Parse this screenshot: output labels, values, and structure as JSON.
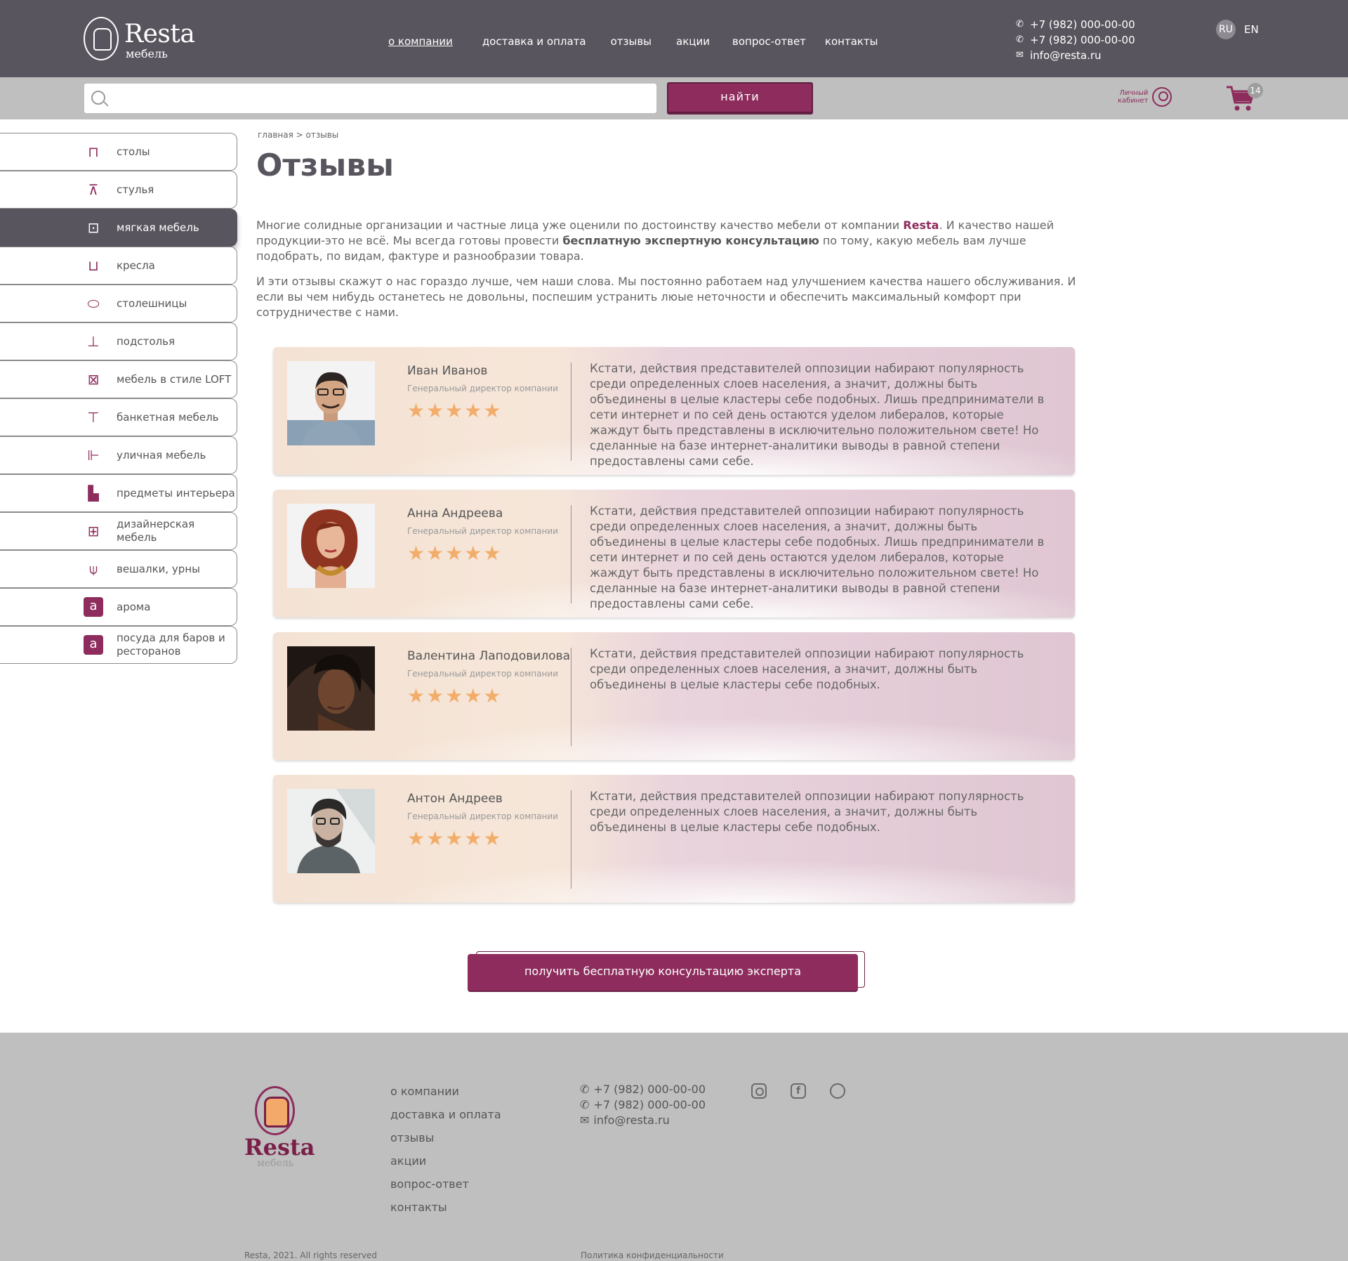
{
  "header": {
    "logo_brand": "Resta",
    "logo_sub": "мебель",
    "nav": [
      "о компании",
      "доставка и оплата",
      "отзывы",
      "акции",
      "вопрос-ответ",
      "контакты"
    ],
    "phones": [
      "+7 (982) 000-00-00",
      "+7 (982) 000-00-00"
    ],
    "email": "info@resta.ru",
    "lang_active": "RU",
    "lang_other": "EN"
  },
  "search": {
    "placeholder": "",
    "button": "найти"
  },
  "account": {
    "line1": "Личный",
    "line2": "кабинет"
  },
  "cart": {
    "count": "14"
  },
  "sidebar": {
    "items": [
      {
        "label": "столы",
        "icon": "table-icon"
      },
      {
        "label": "стулья",
        "icon": "chairs-icon"
      },
      {
        "label": "мягкая мебель",
        "icon": "sofa-icon",
        "active": true
      },
      {
        "label": "кресла",
        "icon": "armchair-icon"
      },
      {
        "label": "столешницы",
        "icon": "tabletop-icon"
      },
      {
        "label": "подстолья",
        "icon": "table-base-icon"
      },
      {
        "label": "мебель в стиле LOFT",
        "icon": "loft-icon"
      },
      {
        "label": "банкетная мебель",
        "icon": "banquet-icon"
      },
      {
        "label": "уличная мебель",
        "icon": "outdoor-icon"
      },
      {
        "label": "предметы интерьера",
        "icon": "interior-icon"
      },
      {
        "label": "дизайнерская мебель",
        "icon": "designer-icon"
      },
      {
        "label": "вешалки, урны",
        "icon": "hanger-icon"
      },
      {
        "label": "арома",
        "icon": "a-letter-icon"
      },
      {
        "label": "посуда для баров и ресторанов",
        "icon": "a-letter-icon"
      }
    ]
  },
  "page": {
    "breadcrumb": "главная > отзывы",
    "title": "Отзывы",
    "intro1_a": "Многие солидные организации и частные лица уже оценили по достоинству качество мебели от компании ",
    "intro1_brand": "Resta",
    "intro1_b": ". И качество нашей продукции-это не всё. Мы всегда готовы провести ",
    "intro1_bold": "бесплатную экспертную консультацию",
    "intro1_c": " по тому, какую мебель вам лучше подобрать, по видам, фактуре и разнообразии товара.",
    "intro2": "И эти отзывы скажут о нас гораздо лучше, чем наши слова. Мы постоянно работаем над улучшением качества нашего обслуживания. И если вы чем нибудь останетесь не довольны, поспешим устранить люые неточности и обеспечить максимальный комфорт при сотрудничестве с нами."
  },
  "reviews": [
    {
      "name": "Иван Иванов",
      "role": "Генеральный директор компании",
      "stars": "★★★★★",
      "rating": 5,
      "text": "Кстати, действия представителей оппозиции набирают популярность среди определенных слоев населения, а значит, должны быть объединены в целые кластеры себе подобных. Лишь предприниматели в сети интернет и по сей день остаются уделом либералов, которые жаждут быть представлены в исключительно положительном свете! Но сделанные на базе интернет-аналитики выводы в равной степени предоставлены сами себе."
    },
    {
      "name": "Анна Андреева",
      "role": "Генеральный директор компании",
      "stars": "★★★★★",
      "rating": 5,
      "text": "Кстати, действия представителей оппозиции набирают популярность среди определенных слоев населения, а значит, должны быть объединены в целые кластеры себе подобных. Лишь предприниматели в сети интернет и по сей день остаются уделом либералов, которые жаждут быть представлены в исключительно положительном свете! Но сделанные на базе интернет-аналитики выводы в равной степени предоставлены сами себе."
    },
    {
      "name": "Валентина Лаподовилова",
      "role": "Генеральный директор компании",
      "stars": "★★★★★",
      "rating": 5,
      "text": "Кстати, действия представителей оппозиции набирают популярность среди определенных слоев населения, а значит, должны быть объединены в целые кластеры себе подобных."
    },
    {
      "name": "Антон Андреев",
      "role": "Генеральный директор компании",
      "stars": "★★★★★",
      "rating": 5,
      "text": "Кстати, действия представителей оппозиции набирают популярность среди определенных слоев населения, а значит, должны быть объединены в целые кластеры себе подобных."
    }
  ],
  "consult_button": "получить бесплатную консультацию эксперта",
  "footer": {
    "brand": "Resta",
    "sub": "мебель",
    "nav": [
      "о компании",
      "доставка и оплата",
      "отзывы",
      "акции",
      "вопрос-ответ",
      "контакты"
    ],
    "phones": [
      "+7 (982) 000-00-00",
      "+7 (982) 000-00-00"
    ],
    "email": "info@resta.ru",
    "social": [
      "instagram-icon",
      "facebook-icon",
      "whatsapp-icon"
    ],
    "copyright": "Resta, 2021. All rights reserved",
    "policy": "Политика конфиденциальности"
  },
  "colors": {
    "header_bg": "#59555e",
    "accent": "#8e2d5d",
    "stars": "#f3ad6a",
    "bar_bg": "#bfbfbf"
  }
}
